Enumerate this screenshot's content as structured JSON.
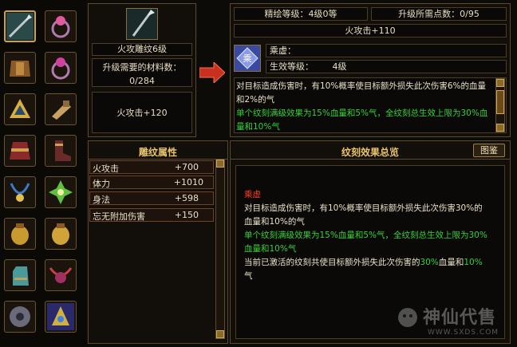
{
  "header": {
    "refine_level": "精绘等级：4级0等",
    "upgrade_points": "升级所需点数：0/95",
    "fire_attack_bonus": "火攻击+110"
  },
  "left_item": {
    "name": "火攻雕纹6级",
    "materials_label": "升级需要的材料数：",
    "materials_value": "0/284",
    "effect": "火攻击+120"
  },
  "skill": {
    "name": "乘虚：",
    "level_label": "生效等级：",
    "level_value": "4级",
    "desc_white": "对目标造成伤害时，有10%概率使目标额外损失此次伤害6%的血量和2%的气",
    "desc_green": "单个纹刻满级效果为15%血量和5%气，全纹刻总生效上限为30%血量和10%气"
  },
  "attrs": {
    "title": "雕纹属性",
    "rows": [
      {
        "name": "火攻击",
        "value": "+700"
      },
      {
        "name": "体力",
        "value": "+1010"
      },
      {
        "name": "身法",
        "value": "+598"
      },
      {
        "name": "忘无附加伤害",
        "value": "+150"
      }
    ]
  },
  "overview": {
    "title": "纹刻效果总览",
    "button": "图鉴",
    "effect_name": "乘虚",
    "line1": "对目标造成伤害时，有10%概率使目标额外损失此次伤害30%的血量和10%的气",
    "line2": "单个纹刻满级效果为15%血量和5%气，全纹刻总生效上限为30%血量和10%气",
    "line3_a": "当前已激活的纹刻共使目标额外损失此次伤害的",
    "line3_b": "30%",
    "line3_c": "血量和",
    "line3_d": "10%",
    "line3_e": "气"
  },
  "watermark": {
    "brand": "神仙代售",
    "url": "WWW.SXDS.COM"
  },
  "icons": [
    "spear-icon",
    "ring-icon",
    "armor-icon",
    "ring-icon",
    "triangle-amulet-icon",
    "bracer-icon",
    "robe-icon",
    "boots-icon",
    "necklace-icon",
    "jade-icon",
    "pouch-icon",
    "pouch-icon",
    "gauntlet-icon",
    "pendant-icon",
    "disc-icon",
    "ornament-icon"
  ]
}
